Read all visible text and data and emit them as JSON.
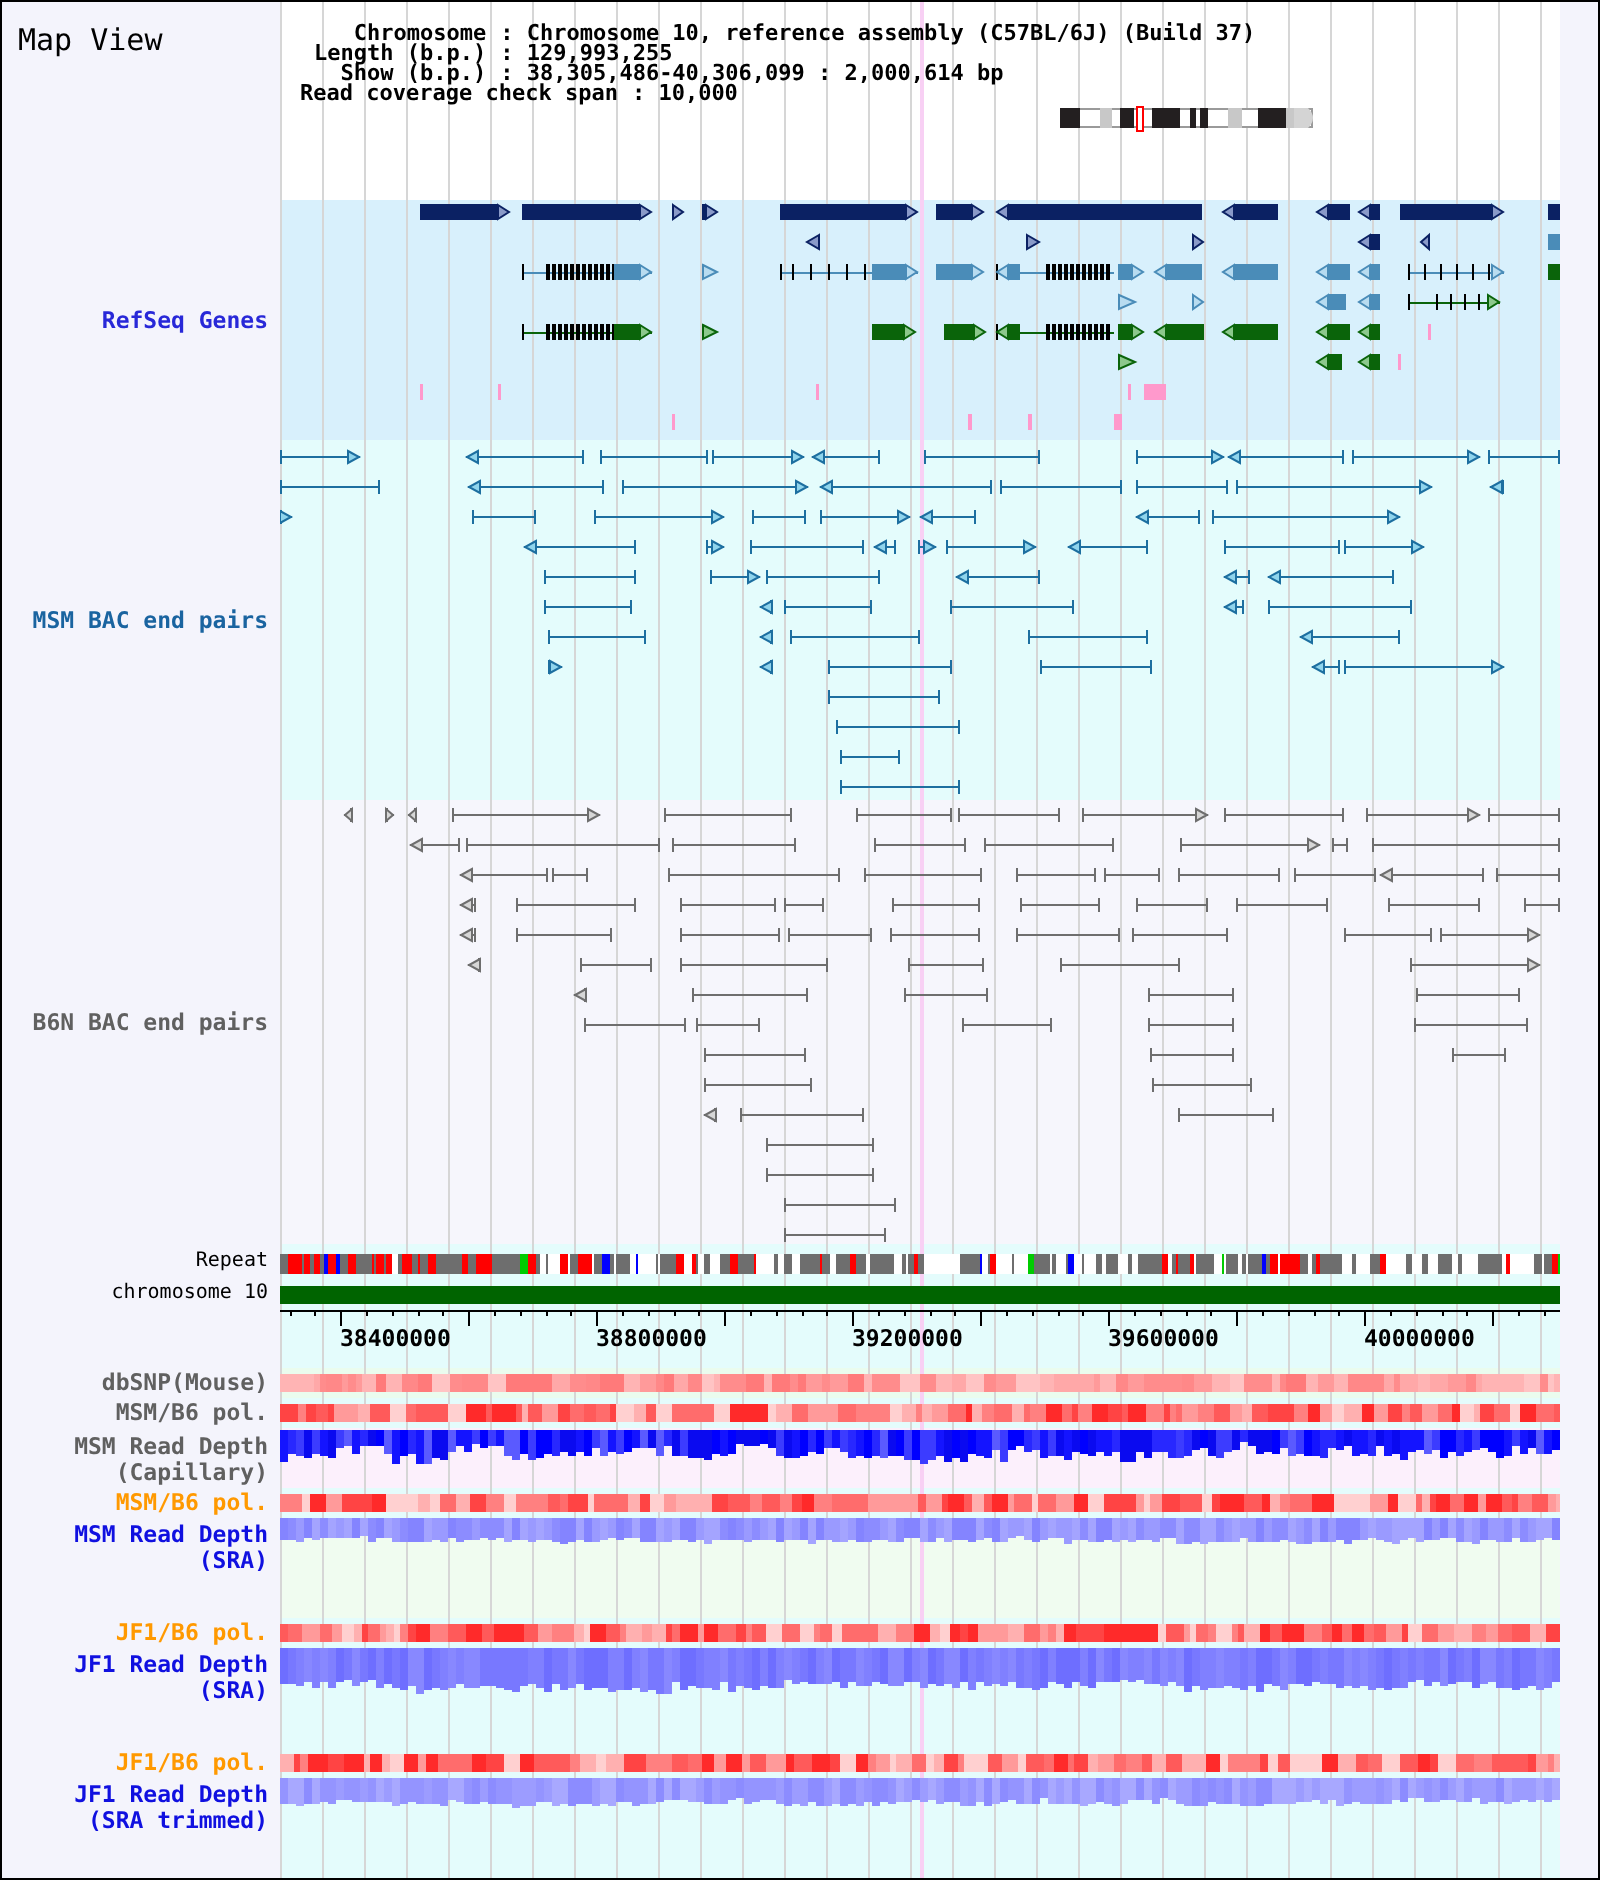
{
  "title": "Map View",
  "info": [
    {
      "label": "Chromosome",
      "value": ": Chromosome 10, reference assembly (C57BL/6J) (Build 37)"
    },
    {
      "label": "Length (b.p.)",
      "value": ": 129,993,255"
    },
    {
      "label": "Show (b.p.)",
      "value": ": 38,305,486-40,306,099 : 2,000,614 bp"
    }
  ],
  "coverage": {
    "label": "Read coverage check span",
    "value": ": 10,000"
  },
  "feature_tracks": [
    {
      "kind": "genes",
      "label": "RefSeq Genes",
      "color": "#2828d8"
    },
    {
      "kind": "pairs",
      "label": "MSM BAC end pairs",
      "color": "#1a64a0"
    },
    {
      "kind": "pairs",
      "label": "B6N BAC end pairs",
      "color": "#606060"
    }
  ],
  "tracks": [
    {
      "kind": "repeat",
      "label": [
        "Repeat"
      ],
      "color": "#000000"
    },
    {
      "kind": "chromosome",
      "label": [
        "chromosome 10"
      ],
      "color": "#000000"
    },
    {
      "kind": "axis",
      "ticks": [
        "38400000",
        "38800000",
        "39200000",
        "39600000",
        "40000000"
      ]
    },
    {
      "kind": "snp",
      "label": [
        "dbSNP(Mouse)"
      ],
      "color": "#606060"
    },
    {
      "kind": "pol",
      "label": [
        "MSM/B6 pol."
      ],
      "color": "#606060"
    },
    {
      "kind": "capillary",
      "label": [
        "MSM Read Depth",
        "(Capillary)"
      ],
      "color": "#606060"
    },
    {
      "kind": "pol",
      "label": [
        "MSM/B6 pol."
      ],
      "color": "#ff9900"
    },
    {
      "kind": "sra",
      "label": [
        "MSM Read Depth",
        "(SRA)"
      ],
      "color": "#1010e0"
    },
    {
      "kind": "pol",
      "label": [
        "JF1/B6 pol."
      ],
      "color": "#ff9900"
    },
    {
      "kind": "sra",
      "label": [
        "JF1 Read Depth",
        "(SRA)"
      ],
      "color": "#1010e0"
    },
    {
      "kind": "pol",
      "label": [
        "JF1/B6 pol."
      ],
      "color": "#ff9900"
    },
    {
      "kind": "sra",
      "label": [
        "JF1 Read Depth",
        "(SRA trimmed)"
      ],
      "color": "#1010e0"
    }
  ]
}
